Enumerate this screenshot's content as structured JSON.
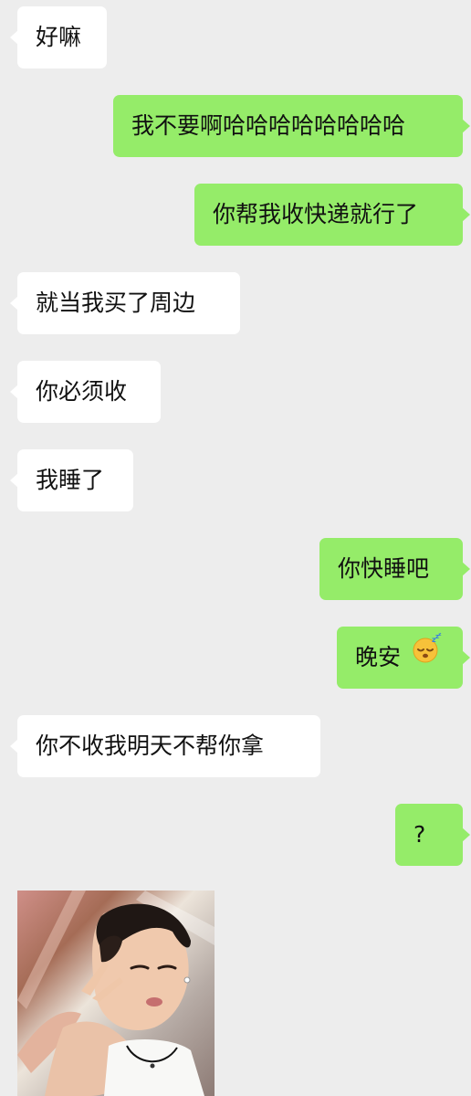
{
  "messages": [
    {
      "side": "in",
      "text": "好嘛"
    },
    {
      "side": "out",
      "text": "我不要啊哈哈哈哈哈哈哈哈"
    },
    {
      "side": "out",
      "text": "你帮我收快递就行了"
    },
    {
      "side": "in",
      "text": "就当我买了周边"
    },
    {
      "side": "in",
      "text": "你必须收"
    },
    {
      "side": "in",
      "text": "我睡了"
    },
    {
      "side": "out",
      "text": "你快睡吧"
    },
    {
      "side": "out",
      "text": "晚安",
      "emoji": "sleeping-face-icon"
    },
    {
      "side": "in",
      "text": "你不收我明天不帮你拿"
    },
    {
      "side": "out",
      "text": "?"
    }
  ],
  "sticker": {
    "kind": "photo-sticker",
    "icon": "photo-sticker-icon"
  },
  "colors": {
    "background": "#ededed",
    "incoming_bubble": "#ffffff",
    "outgoing_bubble": "#95ec69",
    "text": "#111111"
  }
}
